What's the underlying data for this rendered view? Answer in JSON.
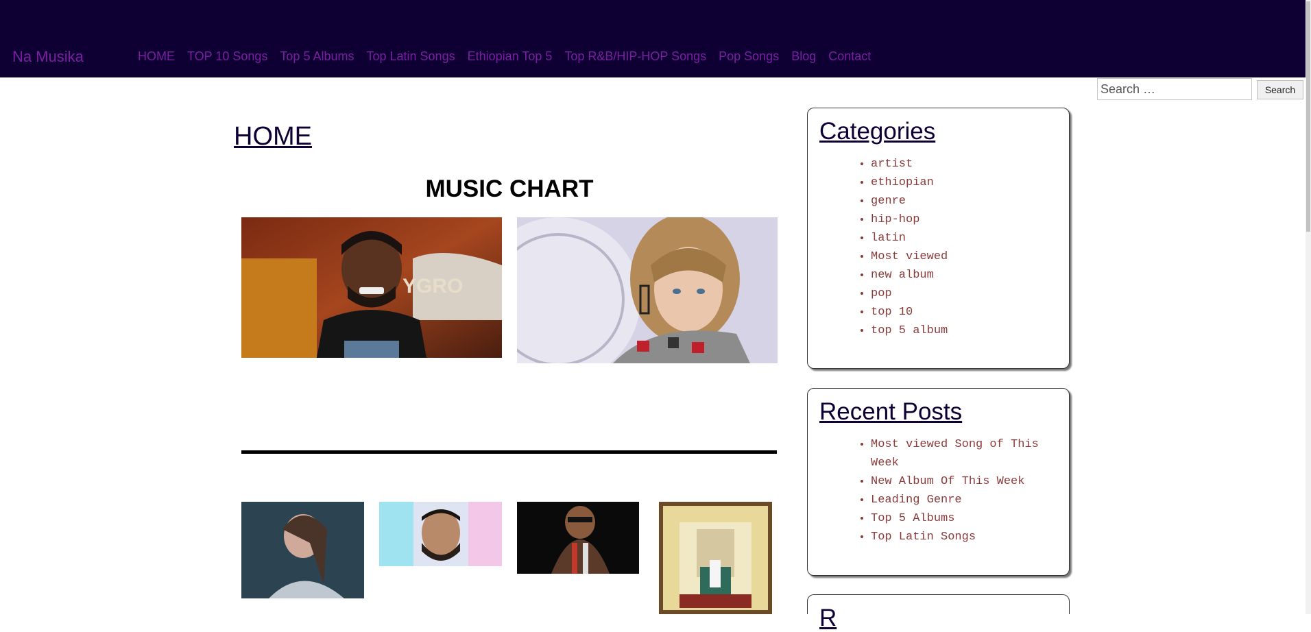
{
  "site": {
    "title": "Na Musika"
  },
  "nav": {
    "items": [
      {
        "label": "HOME"
      },
      {
        "label": "TOP 10 Songs"
      },
      {
        "label": "Top 5 Albums"
      },
      {
        "label": "Top Latin Songs"
      },
      {
        "label": "Ethiopian Top 5"
      },
      {
        "label": "Top R&B/HIP-HOP Songs"
      },
      {
        "label": "Pop Songs"
      },
      {
        "label": "Blog"
      },
      {
        "label": "Contact"
      }
    ]
  },
  "search": {
    "placeholder": "Search …",
    "button_label": "Search"
  },
  "main": {
    "page_title": "HOME",
    "chart_heading": "MUSIC CHART"
  },
  "sidebar": {
    "categories": {
      "title": "Categories",
      "items": [
        "artist",
        "ethiopian",
        "genre",
        "hip-hop",
        "latin",
        "Most viewed",
        "new album",
        "pop",
        "top 10",
        "top 5 album"
      ]
    },
    "recent_posts": {
      "title": "Recent Posts",
      "items": [
        "Most viewed Song of This Week",
        "New Album Of This Week",
        "Leading Genre",
        "Top 5 Albums",
        "Top Latin Songs"
      ]
    },
    "third_widget": {
      "title": "R"
    }
  },
  "colors": {
    "header_bg": "#0f0033",
    "nav_link": "#7b1fa2",
    "list_link": "#8b3a3a"
  }
}
